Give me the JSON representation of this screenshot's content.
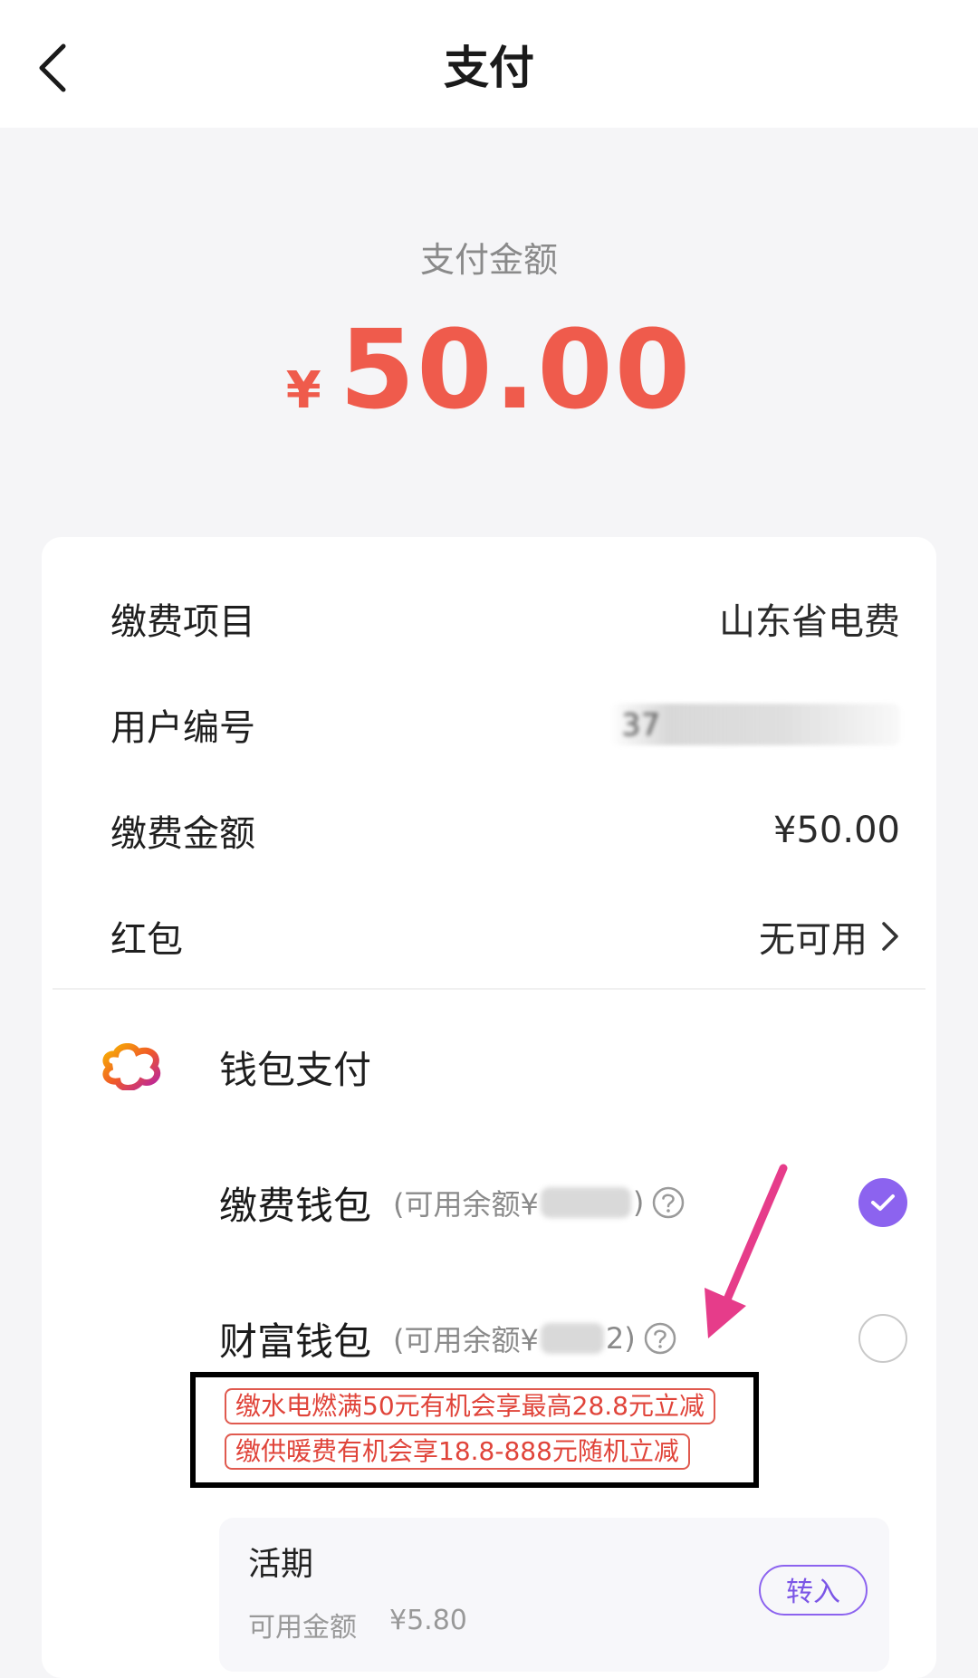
{
  "header": {
    "title": "支付",
    "back_icon": "chevron-left-icon"
  },
  "payment": {
    "amount_label": "支付金额",
    "currency_symbol": "¥",
    "amount_value": "50.00"
  },
  "details": {
    "rows": [
      {
        "label": "缴费项目",
        "value": "山东省电费"
      },
      {
        "label": "用户编号",
        "value": "37"
      },
      {
        "label": "缴费金额",
        "value": "¥50.00"
      },
      {
        "label": "红包",
        "value": "无可用"
      }
    ]
  },
  "wallet": {
    "title": "钱包支付",
    "options": [
      {
        "name": "缴费钱包",
        "balance_prefix": "(可用余额¥",
        "balance_suffix": ")",
        "selected": true
      },
      {
        "name": "财富钱包",
        "balance_prefix": "(可用余额¥",
        "balance_suffix": "2)",
        "selected": false
      }
    ],
    "promos": [
      "缴水电燃满50元有机会享最高28.8元立减",
      "缴供暖费有机会享18.8-888元随机立减"
    ],
    "sub_account": {
      "title": "活期",
      "available_label": "可用金额",
      "available_value": "¥5.80",
      "transfer_label": "转入"
    }
  },
  "colors": {
    "accent": "#8c63ef",
    "amount": "#ef5b4c",
    "promo": "#e0443a",
    "arrow": "#e63c8a"
  }
}
